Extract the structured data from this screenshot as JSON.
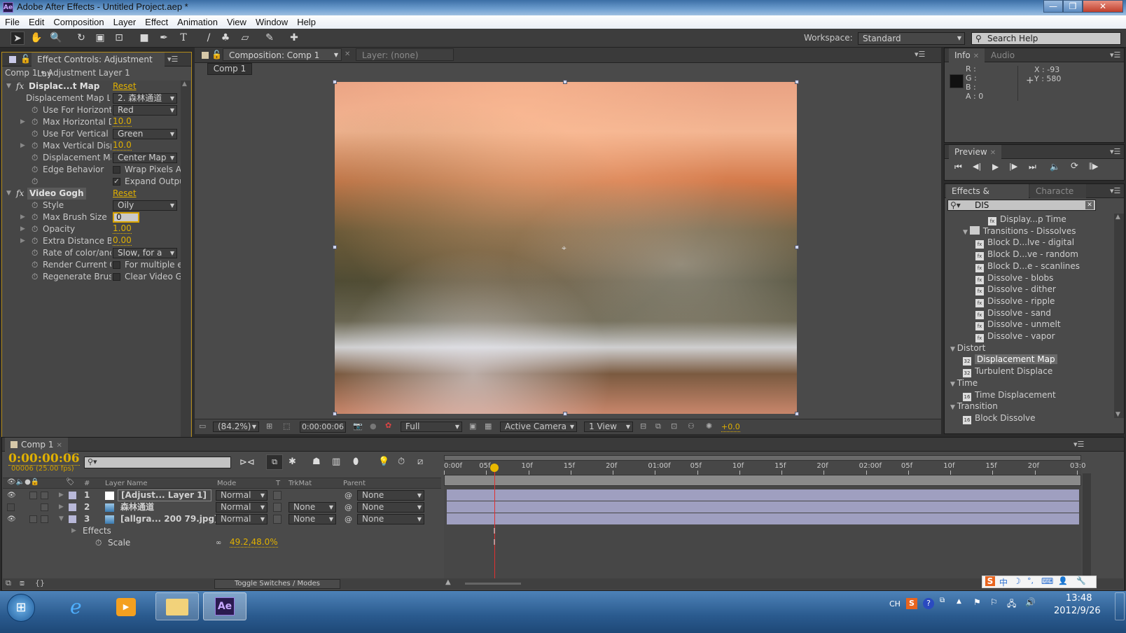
{
  "window": {
    "title": "Adobe After Effects - Untitled Project.aep *",
    "app_badge": "Ae",
    "minimize": "—",
    "maximize": "❐",
    "close": "✕"
  },
  "menu": [
    "File",
    "Edit",
    "Composition",
    "Layer",
    "Effect",
    "Animation",
    "View",
    "Window",
    "Help"
  ],
  "toolbar": {
    "tools": [
      {
        "name": "selection-tool",
        "glyph": "➤"
      },
      {
        "name": "hand-tool",
        "glyph": "✋"
      },
      {
        "name": "zoom-tool",
        "glyph": "🔍"
      },
      {
        "name": "rotation-tool",
        "glyph": "↻"
      },
      {
        "name": "camera-tool",
        "glyph": "▣"
      },
      {
        "name": "pan-behind-tool",
        "glyph": "⊡"
      },
      {
        "name": "rectangle-tool",
        "glyph": "■"
      },
      {
        "name": "pen-tool",
        "glyph": "✒"
      },
      {
        "name": "type-tool",
        "glyph": "T"
      },
      {
        "name": "brush-tool",
        "glyph": "/"
      },
      {
        "name": "clone-stamp-tool",
        "glyph": "♣"
      },
      {
        "name": "eraser-tool",
        "glyph": "▱"
      },
      {
        "name": "roto-brush-tool",
        "glyph": "✎"
      },
      {
        "name": "puppet-pin-tool",
        "glyph": "✚"
      }
    ],
    "workspace_label": "Workspace:",
    "workspace_value": "Standard",
    "search_placeholder": "Search Help"
  },
  "effect_controls": {
    "tab_label": "Effect Controls: Adjustment Lay",
    "breadcrumb": "Comp 1 • Adjustment Layer 1",
    "effects": [
      {
        "name": "Displac...t Map",
        "reset": "Reset",
        "properties": [
          {
            "label": "Displacement Map L",
            "type": "dropdown",
            "value": "2. 森林通道"
          },
          {
            "label": "Use For Horizont",
            "type": "dropdown",
            "value": "Red"
          },
          {
            "label": "Max Horizontal D",
            "type": "value",
            "value": "10.0"
          },
          {
            "label": "Use For Vertical I",
            "type": "dropdown",
            "value": "Green"
          },
          {
            "label": "Max Vertical Disp",
            "type": "value",
            "value": "10.0"
          },
          {
            "label": "Displacement Ma",
            "type": "dropdown",
            "value": "Center Map"
          },
          {
            "label": "Edge Behavior",
            "type": "checkbox",
            "checked": false,
            "value": "Wrap Pixels A"
          },
          {
            "label": "",
            "type": "checkbox",
            "checked": true,
            "value": "Expand Outpu"
          }
        ]
      },
      {
        "name": "Video Gogh",
        "reset": "Reset",
        "properties": [
          {
            "label": "Style",
            "type": "dropdown",
            "value": "Oily"
          },
          {
            "label": "Max Brush Size",
            "type": "input",
            "value": "0"
          },
          {
            "label": "Opacity",
            "type": "value",
            "value": "1.00"
          },
          {
            "label": "Extra Distance Be",
            "type": "value",
            "value": "0.00"
          },
          {
            "label": "Rate of color/anc",
            "type": "dropdown",
            "value": "Slow, for a"
          },
          {
            "label": "Render Current O",
            "type": "checkbox",
            "checked": false,
            "value": "For multiple e"
          },
          {
            "label": "Regenerate Brusl",
            "type": "checkbox",
            "checked": false,
            "value": "Clear Video G"
          }
        ]
      }
    ]
  },
  "composition": {
    "tab_label": "Composition: Comp 1",
    "layer_tab": "Layer: (none)",
    "breadcrumb": "Comp 1",
    "footer": {
      "zoom": "(84.2%)",
      "timecode": "0:00:00:06",
      "resolution": "Full",
      "camera": "Active Camera",
      "views": "1 View",
      "exposure": "+0.0"
    }
  },
  "info": {
    "tab": "Info",
    "audio_tab": "Audio",
    "r": "R :",
    "g": "G :",
    "b": "B :",
    "a": "A : 0",
    "x": "X : -93",
    "y": "Y : 580"
  },
  "preview": {
    "tab": "Preview",
    "controls": [
      {
        "name": "first-frame",
        "glyph": "⏮"
      },
      {
        "name": "previous-frame",
        "glyph": "◀|"
      },
      {
        "name": "play",
        "glyph": "▶"
      },
      {
        "name": "next-frame",
        "glyph": "|▶"
      },
      {
        "name": "last-frame",
        "glyph": "⏭"
      },
      {
        "name": "audio",
        "glyph": "🔈"
      },
      {
        "name": "loop",
        "glyph": "⟳"
      },
      {
        "name": "ram-preview",
        "glyph": "⫼▶"
      }
    ]
  },
  "effects_presets": {
    "tab": "Effects & Presets",
    "character_tab": "Characte",
    "search_value": "DIS",
    "items": [
      {
        "type": "effect",
        "indent": 3,
        "label": "Display...p Time"
      },
      {
        "type": "folder",
        "indent": 1,
        "label": "Transitions - Dissolves"
      },
      {
        "type": "effect",
        "indent": 2,
        "label": "Block D...lve - digital"
      },
      {
        "type": "effect",
        "indent": 2,
        "label": "Block D...ve - random"
      },
      {
        "type": "effect",
        "indent": 2,
        "label": "Block D...e - scanlines"
      },
      {
        "type": "effect",
        "indent": 2,
        "label": "Dissolve - blobs"
      },
      {
        "type": "effect",
        "indent": 2,
        "label": "Dissolve - dither"
      },
      {
        "type": "effect",
        "indent": 2,
        "label": "Dissolve - ripple"
      },
      {
        "type": "effect",
        "indent": 2,
        "label": "Dissolve - sand"
      },
      {
        "type": "effect",
        "indent": 2,
        "label": "Dissolve - unmelt"
      },
      {
        "type": "effect",
        "indent": 2,
        "label": "Dissolve - vapor"
      },
      {
        "type": "category",
        "indent": 0,
        "label": "Distort"
      },
      {
        "type": "effect32",
        "indent": 1,
        "label": "Displacement Map",
        "selected": true
      },
      {
        "type": "effect32",
        "indent": 1,
        "label": "Turbulent Displace"
      },
      {
        "type": "category",
        "indent": 0,
        "label": "Time"
      },
      {
        "type": "effect16",
        "indent": 1,
        "label": "Time Displacement"
      },
      {
        "type": "category",
        "indent": 0,
        "label": "Transition"
      },
      {
        "type": "effect16",
        "indent": 1,
        "label": "Block Dissolve"
      }
    ]
  },
  "timeline": {
    "tab": "Comp 1",
    "timecode": "0:00:00:06",
    "frame_info": "00006 (25.00 fps)",
    "headers": {
      "num": "#",
      "layer_name": "Layer Name",
      "mode": "Mode",
      "t": "T",
      "trkmat": "TrkMat",
      "parent": "Parent"
    },
    "layers": [
      {
        "num": "1",
        "name": "[Adjust... Layer 1]",
        "mode": "Normal",
        "trkmat": "",
        "parent": "None",
        "visible": true,
        "expanded": false
      },
      {
        "num": "2",
        "name": "森林通道",
        "mode": "Normal",
        "trkmat": "None",
        "parent": "None",
        "visible": false,
        "expanded": false
      },
      {
        "num": "3",
        "name": "[allgra... 200 79.jpg]",
        "mode": "Normal",
        "trkmat": "None",
        "parent": "None",
        "visible": true,
        "expanded": true
      }
    ],
    "sub_rows": {
      "effects": "Effects",
      "scale_label": "Scale",
      "scale_value": "49.2,48.0%"
    },
    "ruler": [
      "0:00f",
      "05f",
      "10f",
      "15f",
      "20f",
      "01:00f",
      "05f",
      "10f",
      "15f",
      "20f",
      "02:00f",
      "05f",
      "10f",
      "15f",
      "20f",
      "03:0"
    ],
    "playhead_frame": 6,
    "toggle_label": "Toggle Switches / Modes"
  },
  "ime_bar": [
    "S",
    "中",
    "☽",
    "°,",
    "⌨",
    "👤",
    "🔧"
  ],
  "taskbar": {
    "apps": [
      "start",
      "internet-explorer",
      "media-player",
      "file-explorer",
      "after-effects"
    ],
    "ae_label": "Ae",
    "lang": "CH",
    "time": "13:48",
    "date": "2012/9/26"
  }
}
